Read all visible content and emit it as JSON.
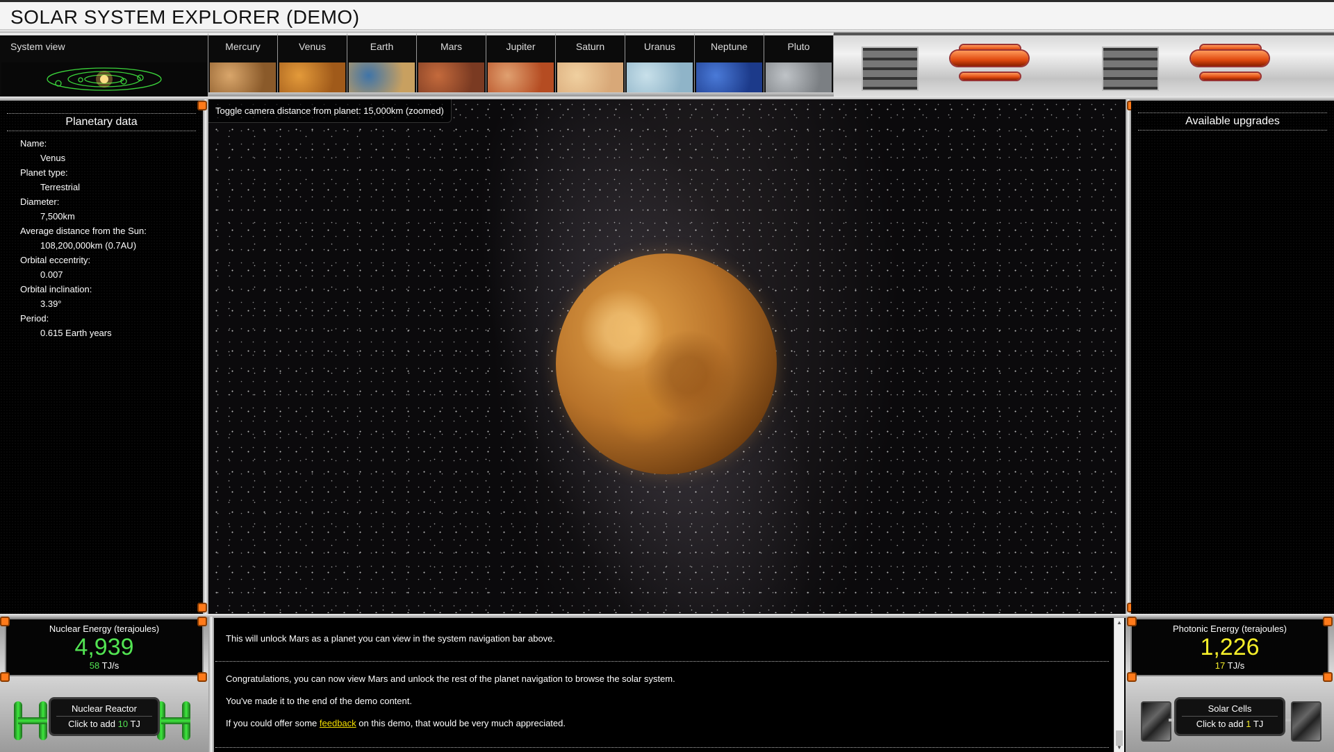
{
  "app": {
    "title": "SOLAR SYSTEM EXPLORER (DEMO)"
  },
  "nav": {
    "system_view": "System view",
    "planets": [
      {
        "label": "Mercury",
        "color_a": "#d9a66b",
        "color_b": "#8a5a2a"
      },
      {
        "label": "Venus",
        "color_a": "#e39a3a",
        "color_b": "#a05a1a"
      },
      {
        "label": "Earth",
        "color_a": "#3f74a8",
        "color_b": "#c8a060"
      },
      {
        "label": "Mars",
        "color_a": "#c46a3c",
        "color_b": "#7a3a22"
      },
      {
        "label": "Jupiter",
        "color_a": "#e0a070",
        "color_b": "#b54c22"
      },
      {
        "label": "Saturn",
        "color_a": "#f0d0a0",
        "color_b": "#d8a878"
      },
      {
        "label": "Uranus",
        "color_a": "#c8e0ea",
        "color_b": "#8fb4c8"
      },
      {
        "label": "Neptune",
        "color_a": "#4a7ad8",
        "color_b": "#1c3a8a"
      },
      {
        "label": "Pluto",
        "color_a": "#bfc3c7",
        "color_b": "#7b7f83"
      }
    ]
  },
  "planetary_data": {
    "title": "Planetary data",
    "fields": [
      {
        "label": "Name:",
        "value": "Venus"
      },
      {
        "label": "Planet type:",
        "value": "Terrestrial"
      },
      {
        "label": "Diameter:",
        "value": "7,500km"
      },
      {
        "label": "Average distance from the Sun:",
        "value": "108,200,000km (0.7AU)"
      },
      {
        "label": "Orbital eccentrity:",
        "value": "0.007"
      },
      {
        "label": "Orbital inclination:",
        "value": "3.39°"
      },
      {
        "label": "Period:",
        "value": "0.615 Earth years"
      }
    ]
  },
  "viewport": {
    "toggle_text": "Toggle camera distance from planet: 15,000km (zoomed)"
  },
  "upgrades": {
    "title": "Available upgrades"
  },
  "nuclear": {
    "label": "Nuclear Energy (terajoules)",
    "value": "4,939",
    "rate_value": "58",
    "rate_unit": " TJ/s",
    "color": "#52e452",
    "generator_name": "Nuclear Reactor",
    "click_prefix": "Click to add ",
    "click_amount": "10",
    "click_unit": " TJ"
  },
  "photonic": {
    "label": "Photonic Energy (terajoules)",
    "value": "1,226",
    "rate_value": "17",
    "rate_unit": " TJ/s",
    "color": "#f5ee2a",
    "generator_name": "Solar Cells",
    "click_prefix": "Click to add ",
    "click_amount": "1",
    "click_unit": " TJ"
  },
  "log": {
    "msg1": "This will unlock Mars as a planet you can view in the system navigation bar above.",
    "msg2": "Congratulations, you can now view Mars and unlock the rest of the planet navigation to browse the solar system.",
    "msg3": "You've made it to the end of the demo content.",
    "msg4_before": "If you could offer some ",
    "msg4_link": "feedback",
    "msg4_after": " on this demo, that would be very much appreciated."
  }
}
